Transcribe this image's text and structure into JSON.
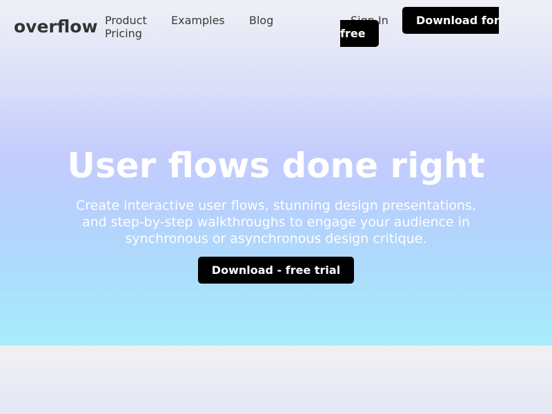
{
  "brand": {
    "logo_text": "overflow"
  },
  "nav": {
    "items": [
      {
        "label": "Product"
      },
      {
        "label": "Examples"
      },
      {
        "label": "Blog"
      },
      {
        "label": "Pricing"
      }
    ],
    "sign_in": "Sign In",
    "download_label_line1": "Download for",
    "download_label_line2": "free"
  },
  "hero": {
    "headline": "User flows done right",
    "subcopy": "Create interactive user flows, stunning design presentations, and step-by-step walkthroughs to engage your audience in synchronous or asynchronous design critique.",
    "cta_label": "Download - free trial"
  },
  "colors": {
    "button_bg": "#000000",
    "button_text": "#ffffff",
    "hero_gradient_top": "#eff0f5",
    "hero_gradient_mid": "#c4ccfe",
    "hero_gradient_bottom": "#a9edfd",
    "text_dark": "#333333"
  }
}
